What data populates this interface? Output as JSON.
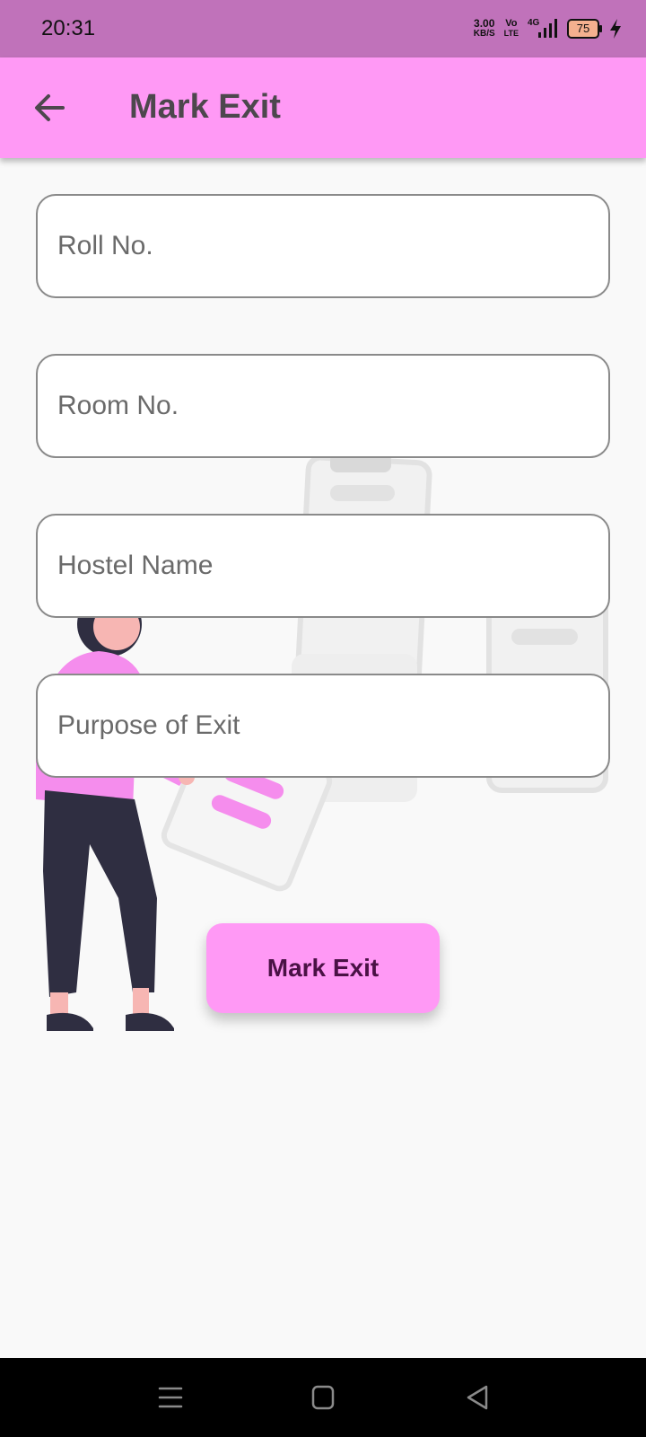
{
  "status_bar": {
    "time": "20:31",
    "net_speed_value": "3.00",
    "net_speed_unit": "KB/S",
    "volte_top": "Vo",
    "volte_bottom": "LTE",
    "network": "4G",
    "battery_level": "75",
    "icons": [
      "signal-icon",
      "battery-icon",
      "charging-icon"
    ]
  },
  "app_bar": {
    "title": "Mark Exit",
    "back_icon": "arrow-left-icon"
  },
  "form": {
    "roll_no": {
      "placeholder": "Roll No.",
      "value": ""
    },
    "room_no": {
      "placeholder": "Room No.",
      "value": ""
    },
    "hostel_name": {
      "placeholder": "Hostel Name",
      "value": ""
    },
    "purpose": {
      "placeholder": "Purpose of Exit",
      "value": ""
    },
    "submit_label": "Mark Exit"
  },
  "nav_bar": {
    "icons": [
      "menu-icon",
      "home-icon",
      "back-icon"
    ]
  },
  "colors": {
    "status_bar": "#c072ba",
    "app_bar": "#ff99f5",
    "accent": "#ff99f5",
    "title_text": "#4d474d",
    "button_text": "#4a1145"
  }
}
